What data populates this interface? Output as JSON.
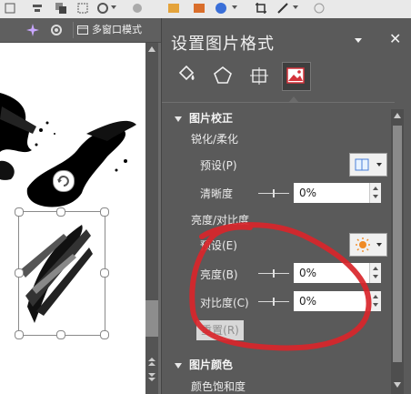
{
  "toolbar": {
    "window_mode_label": "多窗口模式"
  },
  "pane": {
    "title": "设置图片格式",
    "tabs": [
      {
        "name": "fill-line",
        "icon": "paint-bucket-icon"
      },
      {
        "name": "effects",
        "icon": "pentagon-icon"
      },
      {
        "name": "size-properties",
        "icon": "size-properties-icon"
      },
      {
        "name": "picture",
        "icon": "picture-icon"
      }
    ],
    "sections": {
      "correction": {
        "title": "图片校正",
        "sharpen_group": "锐化/柔化",
        "preset_label": "预设(P)",
        "clarity_label": "清晰度",
        "clarity_value": "0%",
        "brightness_group": "亮度/对比度",
        "preset2_label": "预设(E)",
        "brightness_label": "亮度(B)",
        "brightness_value": "0%",
        "contrast_label": "对比度(C)",
        "contrast_value": "0%",
        "reset_label": "重置(R)"
      },
      "color": {
        "title": "图片颜色",
        "saturation_group": "颜色饱和度"
      }
    }
  },
  "annotation": {
    "color": "#d9252a"
  }
}
